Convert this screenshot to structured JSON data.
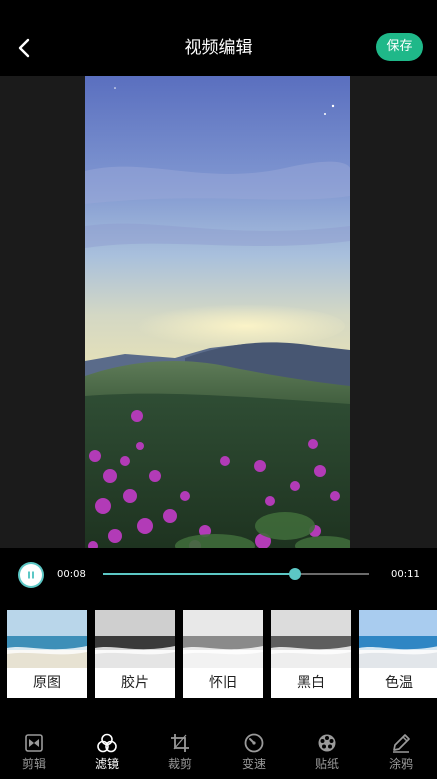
{
  "header": {
    "title": "视频编辑",
    "save_label": "保存",
    "back_icon": "chevron-left-icon"
  },
  "player": {
    "current_time": "00:08",
    "total_time": "00:11",
    "progress": 0.72,
    "play_icon": "pause-icon"
  },
  "filters": [
    {
      "label": "原图",
      "style": "original"
    },
    {
      "label": "胶片",
      "style": "film"
    },
    {
      "label": "怀旧",
      "style": "vintage"
    },
    {
      "label": "黑白",
      "style": "mono"
    },
    {
      "label": "色温",
      "style": "warm"
    }
  ],
  "toolbar": [
    {
      "label": "剪辑",
      "icon": "clip-icon",
      "active": false
    },
    {
      "label": "滤镜",
      "icon": "filter-icon",
      "active": true
    },
    {
      "label": "裁剪",
      "icon": "crop-icon",
      "active": false
    },
    {
      "label": "变速",
      "icon": "speed-icon",
      "active": false
    },
    {
      "label": "贴纸",
      "icon": "sticker-icon",
      "active": false
    },
    {
      "label": "涂鸦",
      "icon": "doodle-icon",
      "active": false
    }
  ],
  "colors": {
    "accent": "#1fb889",
    "progress": "#5cc7c5",
    "background": "#000000",
    "preview_bg": "#1b1b1b"
  }
}
